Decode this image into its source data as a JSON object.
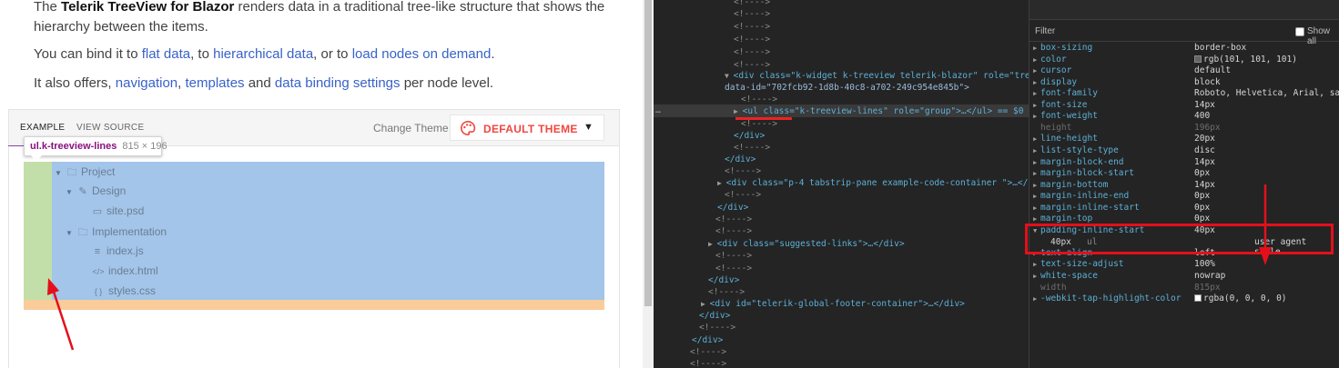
{
  "docs": {
    "p1_bold": "Telerik TreeView for Blazor",
    "p1_pre": "The ",
    "p1_post": " renders data in a traditional tree-like structure that shows the hierarchy between the items.",
    "p2_pre": "You can bind it to ",
    "p2_link1": "flat data",
    "p2_mid1": ", to ",
    "p2_link2": "hierarchical data",
    "p2_mid2": ", or to ",
    "p2_link3": "load nodes on demand",
    "p2_post": ".",
    "p3_pre": "It also offers, ",
    "p3_link1": "navigation",
    "p3_mid1": ", ",
    "p3_link2": "templates",
    "p3_mid2": " and ",
    "p3_link3": "data binding settings",
    "p3_post": " per node level.",
    "link_color": "#3862c9"
  },
  "demo": {
    "tab_example": "EXAMPLE",
    "tab_source": "VIEW SOURCE",
    "change_theme": "Change Theme",
    "theme_value": "DEFAULT THEME",
    "theme_color": "#f0473f",
    "tooltip_selector": "ul.k-treeview-lines",
    "tooltip_size": "815 × 196",
    "tree": [
      {
        "label": "Project",
        "icon": "folder-icon",
        "expanded": true,
        "level": 0
      },
      {
        "label": "Design",
        "icon": "brush-icon",
        "expanded": true,
        "level": 1
      },
      {
        "label": "site.psd",
        "icon": "file-icon",
        "level": 2
      },
      {
        "label": "Implementation",
        "icon": "folder-icon",
        "expanded": true,
        "level": 1
      },
      {
        "label": "index.js",
        "icon": "js-file-icon",
        "level": 2
      },
      {
        "label": "index.html",
        "icon": "code-icon",
        "level": 2
      },
      {
        "label": "styles.css",
        "icon": "css-icon",
        "level": 2
      }
    ]
  },
  "elements": {
    "comment": "<!---->",
    "treeview_div_open": "<div class=\"k-widget k-treeview telerik-blazor\" role=\"tree\"",
    "data_id": "data-id=\"702fcb92-1d8b-40c8-a702-249c954e845b\">",
    "selected_ul": "<ul class=\"k-treeview-lines\" role=\"group\">…</ul> == $0",
    "div_close": "</div>",
    "tabstrip_div": "<div class=\"p-4 tabstrip-pane example-code-container \">…</div>",
    "suggested_div": "<div class=\"suggested-links\">…</div>",
    "footer_div": "<div id=\"telerik-global-footer-container\">…</div>"
  },
  "computed": {
    "filter_label": "Filter",
    "show_all_label": "Show all",
    "properties": [
      {
        "name": "box-sizing",
        "value": "border-box"
      },
      {
        "name": "color",
        "value": "rgb(101, 101, 101)",
        "swatch": "#656565"
      },
      {
        "name": "cursor",
        "value": "default"
      },
      {
        "name": "display",
        "value": "block"
      },
      {
        "name": "font-family",
        "value": "Roboto, Helvetica, Arial, sans-s"
      },
      {
        "name": "font-size",
        "value": "14px"
      },
      {
        "name": "font-weight",
        "value": "400"
      },
      {
        "name": "height",
        "value": "196px",
        "inherited": true
      },
      {
        "name": "line-height",
        "value": "20px"
      },
      {
        "name": "list-style-type",
        "value": "disc"
      },
      {
        "name": "margin-block-end",
        "value": "14px"
      },
      {
        "name": "margin-block-start",
        "value": "0px"
      },
      {
        "name": "margin-bottom",
        "value": "14px"
      },
      {
        "name": "margin-inline-end",
        "value": "0px"
      },
      {
        "name": "margin-inline-start",
        "value": "0px"
      },
      {
        "name": "margin-top",
        "value": "0px"
      },
      {
        "name": "padding-inline-start",
        "value": "40px",
        "expanded": true
      },
      {
        "name": "text-align",
        "value": "left"
      },
      {
        "name": "text-size-adjust",
        "value": "100%"
      },
      {
        "name": "white-space",
        "value": "nowrap"
      },
      {
        "name": "width",
        "value": "815px",
        "inherited": true
      },
      {
        "name": "-webkit-tap-highlight-color",
        "value": "rgba(0, 0, 0, 0)",
        "swatch": "#ffffff"
      }
    ],
    "sub_value": "40px",
    "sub_selector": "ul",
    "sub_origin": "user agent style"
  }
}
